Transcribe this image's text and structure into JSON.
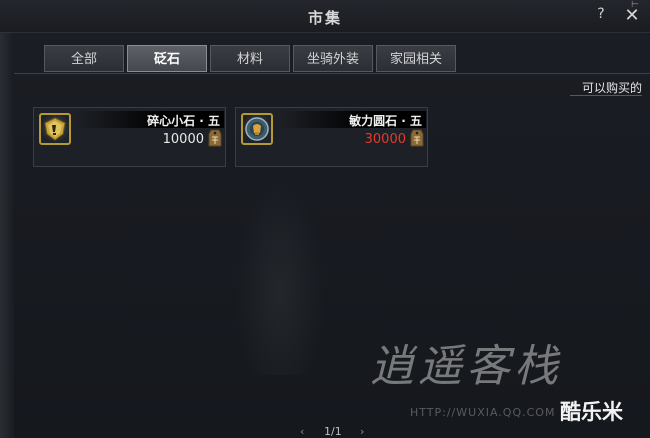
{
  "window": {
    "title": "市集",
    "help_label": "?",
    "close_label": "✕"
  },
  "tabs": [
    {
      "label": "全部",
      "active": false
    },
    {
      "label": "砭石",
      "active": true
    },
    {
      "label": "材料",
      "active": false
    },
    {
      "label": "坐骑外装",
      "active": false
    },
    {
      "label": "家园相关",
      "active": false
    }
  ],
  "filter": {
    "label": "可以购买的"
  },
  "items": [
    {
      "name": "碎心小石 · 五",
      "price": "10000",
      "affordable": true,
      "icon": "shield-gem-icon",
      "currency_icon": "coin-tag-icon"
    },
    {
      "name": "敏力圆石 · 五",
      "price": "30000",
      "affordable": false,
      "icon": "fist-gem-icon",
      "currency_icon": "coin-tag-icon"
    }
  ],
  "pagination": {
    "prev": "‹",
    "label": "1/1",
    "next": "›"
  },
  "watermark": {
    "text": "逍遥客栈",
    "url": "HTTP://WUXIA.QQ.COM",
    "site": "酷乐米"
  },
  "colors": {
    "unaffordable_price": "#e33a2c",
    "icon_border": "#b59a34"
  }
}
